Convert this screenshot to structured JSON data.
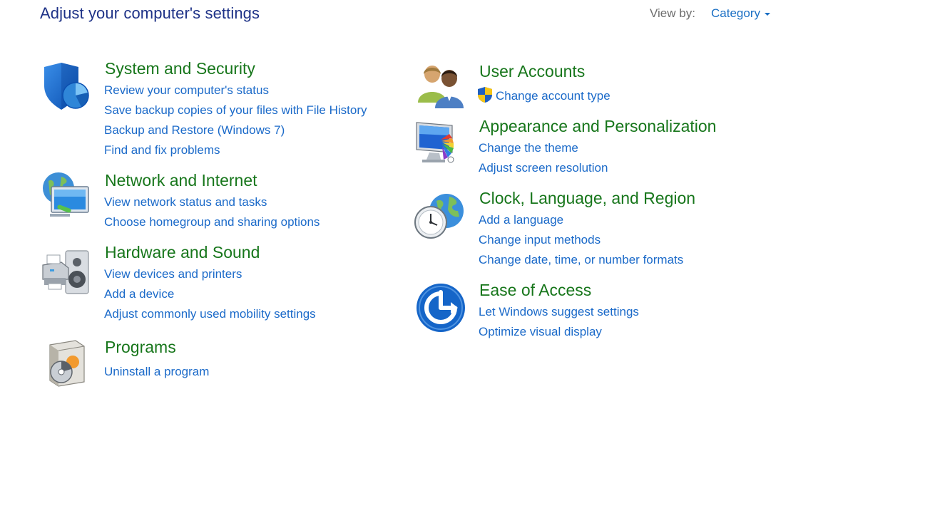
{
  "page": {
    "title": "Adjust your computer's settings",
    "view_by_label": "View by:",
    "view_by_value": "Category"
  },
  "categories": {
    "system": {
      "title": "System and Security",
      "icon": "security-shield-icon",
      "links": [
        "Review your computer's status",
        "Save backup copies of your files with File History",
        "Backup and Restore (Windows 7)",
        "Find and fix problems"
      ]
    },
    "network": {
      "title": "Network and Internet",
      "icon": "network-globe-icon",
      "links": [
        "View network status and tasks",
        "Choose homegroup and sharing options"
      ]
    },
    "hardware": {
      "title": "Hardware and Sound",
      "icon": "printer-speaker-icon",
      "links": [
        "View devices and printers",
        "Add a device",
        "Adjust commonly used mobility settings"
      ]
    },
    "programs": {
      "title": "Programs",
      "icon": "programs-disc-icon",
      "links": [
        "Uninstall a program"
      ]
    },
    "users": {
      "title": "User Accounts",
      "icon": "users-icon",
      "links": [
        "Change account type"
      ]
    },
    "appearance": {
      "title": "Appearance and Personalization",
      "icon": "monitor-palette-icon",
      "links": [
        "Change the theme",
        "Adjust screen resolution"
      ]
    },
    "clock": {
      "title": "Clock, Language, and Region",
      "icon": "clock-globe-icon",
      "links": [
        "Add a language",
        "Change input methods",
        "Change date, time, or number formats"
      ]
    },
    "ease": {
      "title": "Ease of Access",
      "icon": "ease-of-access-icon",
      "links": [
        "Let Windows suggest settings",
        "Optimize visual display"
      ]
    }
  },
  "colors": {
    "title_blue": "#1e3287",
    "category_green": "#17761b",
    "link_blue": "#1b6ac9"
  }
}
